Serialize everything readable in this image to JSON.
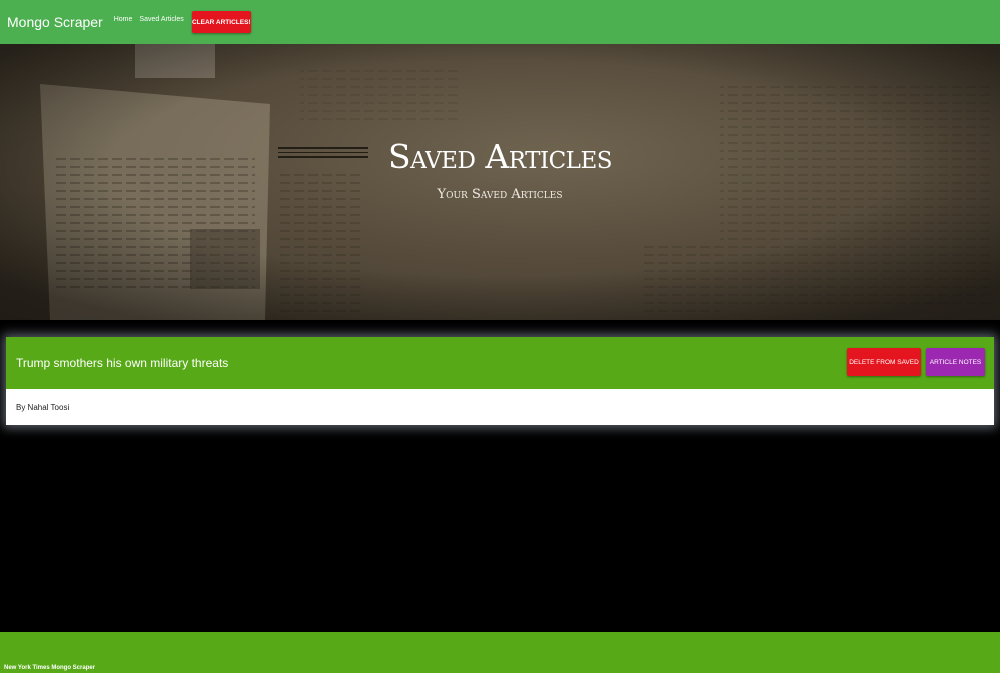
{
  "navbar": {
    "brand": "Mongo Scraper",
    "links": [
      "Home",
      "Saved Articles"
    ],
    "clear_button": "CLEAR ARTICLES!"
  },
  "hero": {
    "title": "Saved Articles",
    "subtitle": "Your Saved Articles"
  },
  "article": {
    "title": "Trump smothers his own military threats",
    "byline": "By Nahal Toosi",
    "delete_button": "DELETE FROM SAVED",
    "notes_button": "ARTICLE NOTES"
  },
  "footer": {
    "text": "New York Times Mongo Scraper"
  },
  "colors": {
    "navbar": "#4caf50",
    "card_header": "#57a918",
    "delete": "#e4151f",
    "notes": "#9c27b0"
  }
}
